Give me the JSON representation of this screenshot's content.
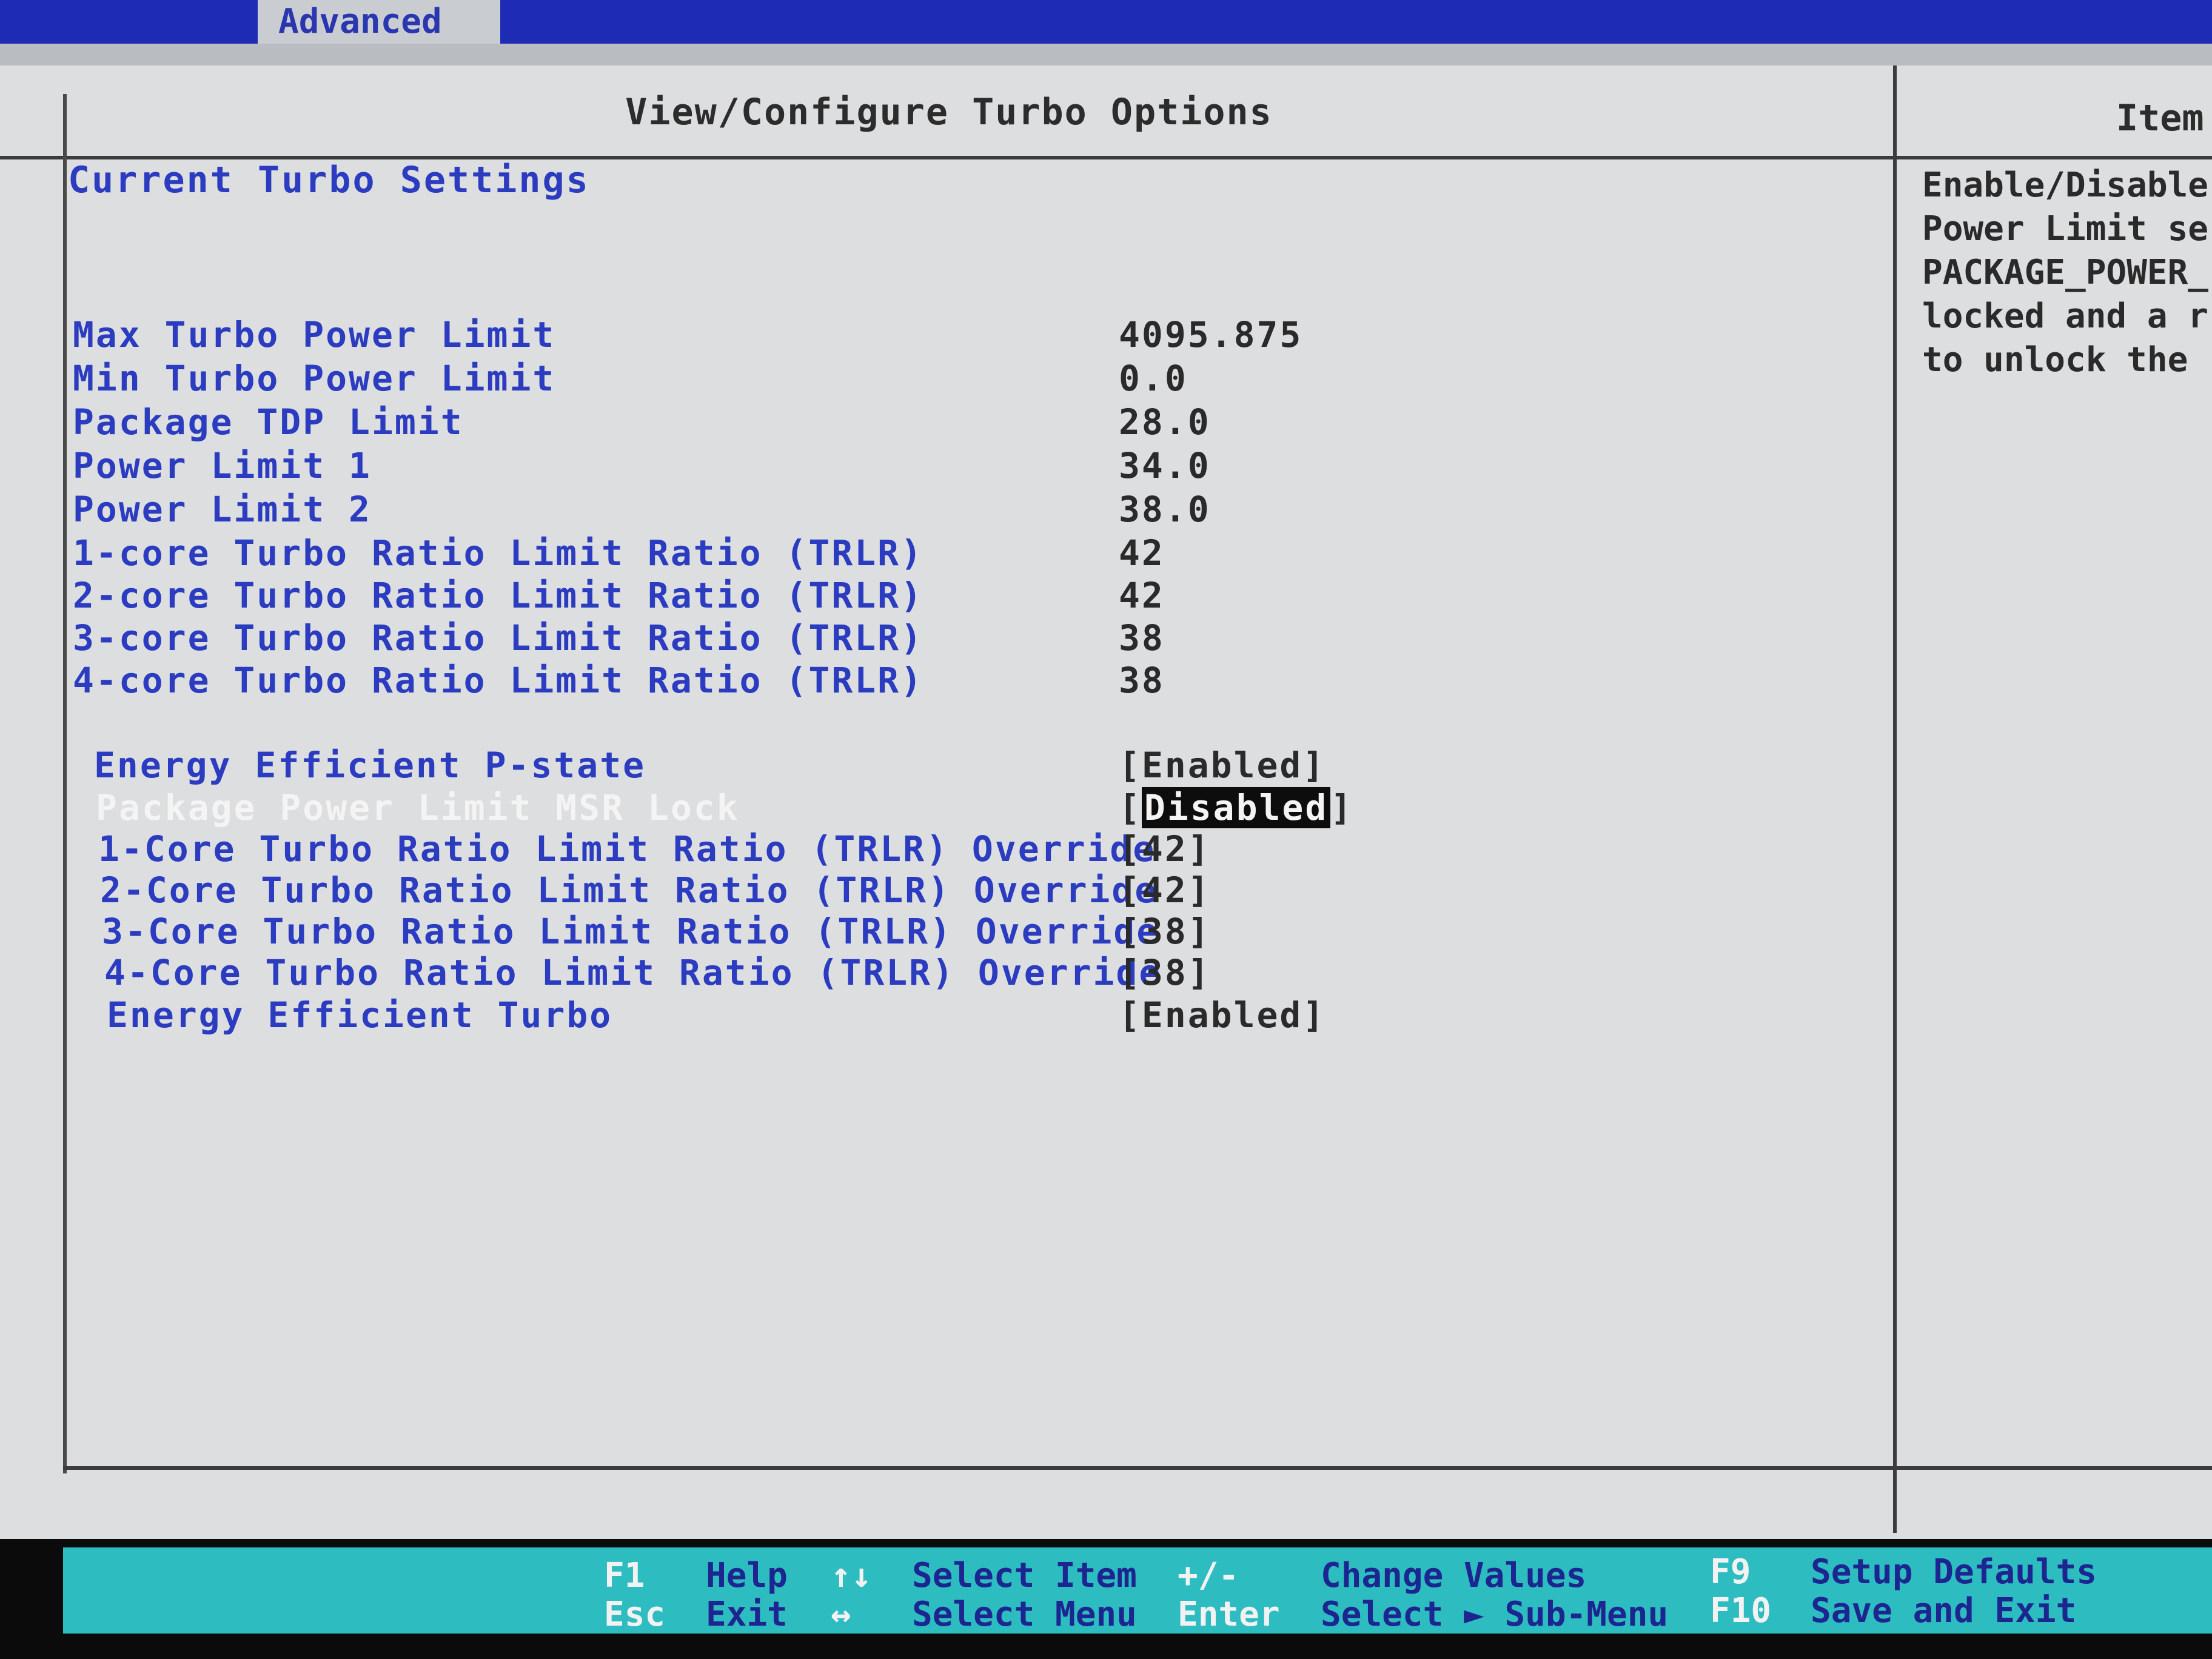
{
  "menu": {
    "active_tab": "Advanced"
  },
  "header": {
    "title": "View/Configure Turbo Options",
    "help_title": "Item"
  },
  "section_title": "Current Turbo Settings",
  "info_rows": [
    {
      "label": "Max Turbo Power Limit",
      "value": "4095.875"
    },
    {
      "label": "Min Turbo Power Limit",
      "value": "0.0"
    },
    {
      "label": "Package TDP Limit",
      "value": "28.0"
    },
    {
      "label": "Power Limit 1",
      "value": "34.0"
    },
    {
      "label": "Power Limit 2",
      "value": "38.0"
    },
    {
      "label": "1-core Turbo Ratio Limit Ratio (TRLR)",
      "value": "42"
    },
    {
      "label": "2-core Turbo Ratio Limit Ratio (TRLR)",
      "value": "42"
    },
    {
      "label": "3-core Turbo Ratio Limit Ratio (TRLR)",
      "value": "38"
    },
    {
      "label": "4-core Turbo Ratio Limit Ratio (TRLR)",
      "value": "38"
    }
  ],
  "option_rows": [
    {
      "label": "Energy Efficient P-state",
      "value": "[Enabled]"
    },
    {
      "label": "Package Power Limit MSR Lock",
      "value_open": "[",
      "value": "Disabled",
      "value_close": "]"
    },
    {
      "label": "1-Core Turbo Ratio Limit Ratio (TRLR) Override",
      "value": "[42]"
    },
    {
      "label": "2-Core Turbo Ratio Limit Ratio (TRLR) Override",
      "value": "[42]"
    },
    {
      "label": "3-Core Turbo Ratio Limit Ratio (TRLR) Override",
      "value": "[38]"
    },
    {
      "label": "4-Core Turbo Ratio Limit Ratio (TRLR) Override",
      "value": "[38]"
    },
    {
      "label": "Energy Efficient Turbo",
      "value": "[Enabled]"
    }
  ],
  "help_text": "Enable/Disable\nPower Limit se\nPACKAGE_POWER_\nlocked and a r\nto unlock the ",
  "status": {
    "f1_key": "F1",
    "f1_desc": "Help",
    "esc_key": "Esc",
    "esc_desc": "Exit",
    "updown_key": "↑↓",
    "updown_desc": "Select Item",
    "leftright_key": "↔",
    "leftright_desc": "Select Menu",
    "plusminus_key": "+/-",
    "plusminus_desc": "Change Values",
    "enter_key": "Enter",
    "enter_desc": "Select ► Sub-Menu",
    "f9_key": "F9",
    "f9_desc": "Setup Defaults",
    "f10_key": "F10",
    "f10_desc": "Save and Exit"
  },
  "colors": {
    "menubar": "#1e2bb4",
    "label_blue": "#2b3cc0",
    "panel_bg": "#dcdedf",
    "statusbar": "#2dbcc0"
  }
}
